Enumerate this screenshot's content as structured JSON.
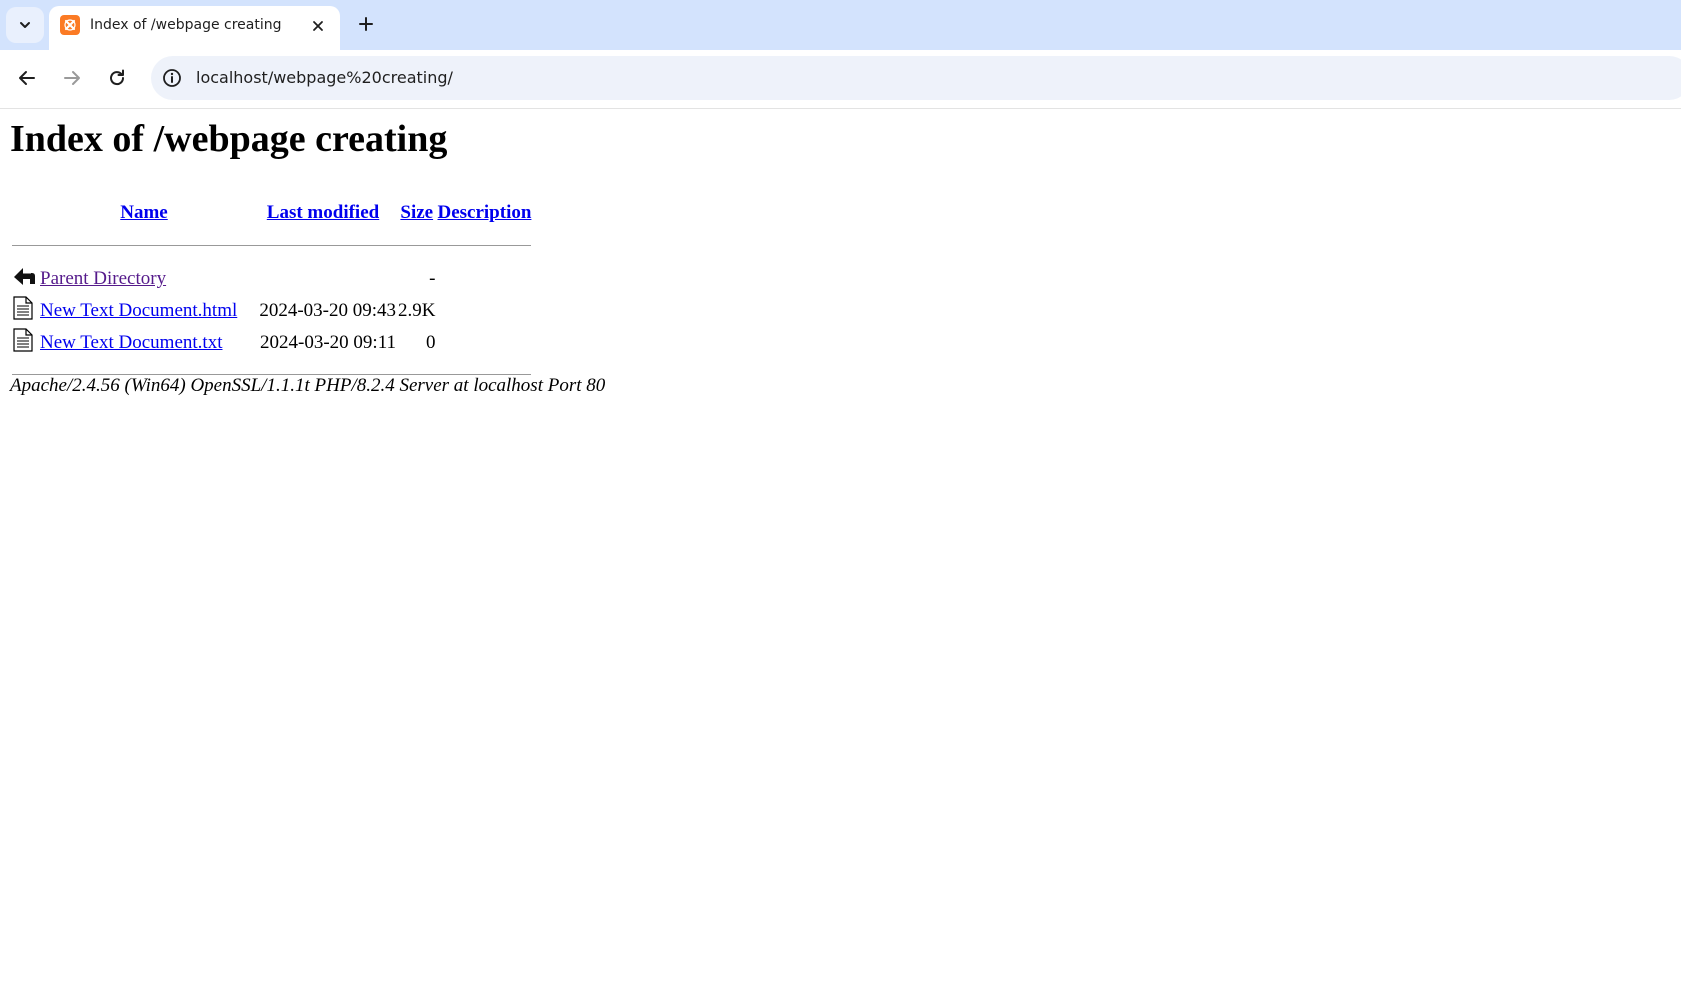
{
  "browser": {
    "tab": {
      "title": "Index of /webpage creating",
      "favicon": "xampp-icon",
      "accent": "#fb7a24"
    },
    "address_bar": {
      "url": "localhost/webpage%20creating/"
    },
    "colors": {
      "tabstrip": "#d3e3fd",
      "omnibox": "#eef2fa"
    }
  },
  "page": {
    "heading": "Index of /webpage creating",
    "columns": {
      "name": "Name",
      "modified": "Last modified",
      "size": "Size",
      "description": "Description"
    },
    "rows": [
      {
        "icon": "back-arrow-icon",
        "name": "Parent Directory",
        "modified": "",
        "size": "-",
        "description": ""
      },
      {
        "icon": "text-file-icon",
        "name": "New Text Document.html",
        "modified": "2024-03-20 09:43",
        "size": "2.9K",
        "description": ""
      },
      {
        "icon": "text-file-icon",
        "name": "New Text Document.txt",
        "modified": "2024-03-20 09:11",
        "size": "0",
        "description": ""
      }
    ],
    "footer": "Apache/2.4.56 (Win64) OpenSSL/1.1.1t PHP/8.2.4 Server at localhost Port 80",
    "colors": {
      "link": "#0000ee",
      "visited_link": "#551a8b"
    }
  }
}
